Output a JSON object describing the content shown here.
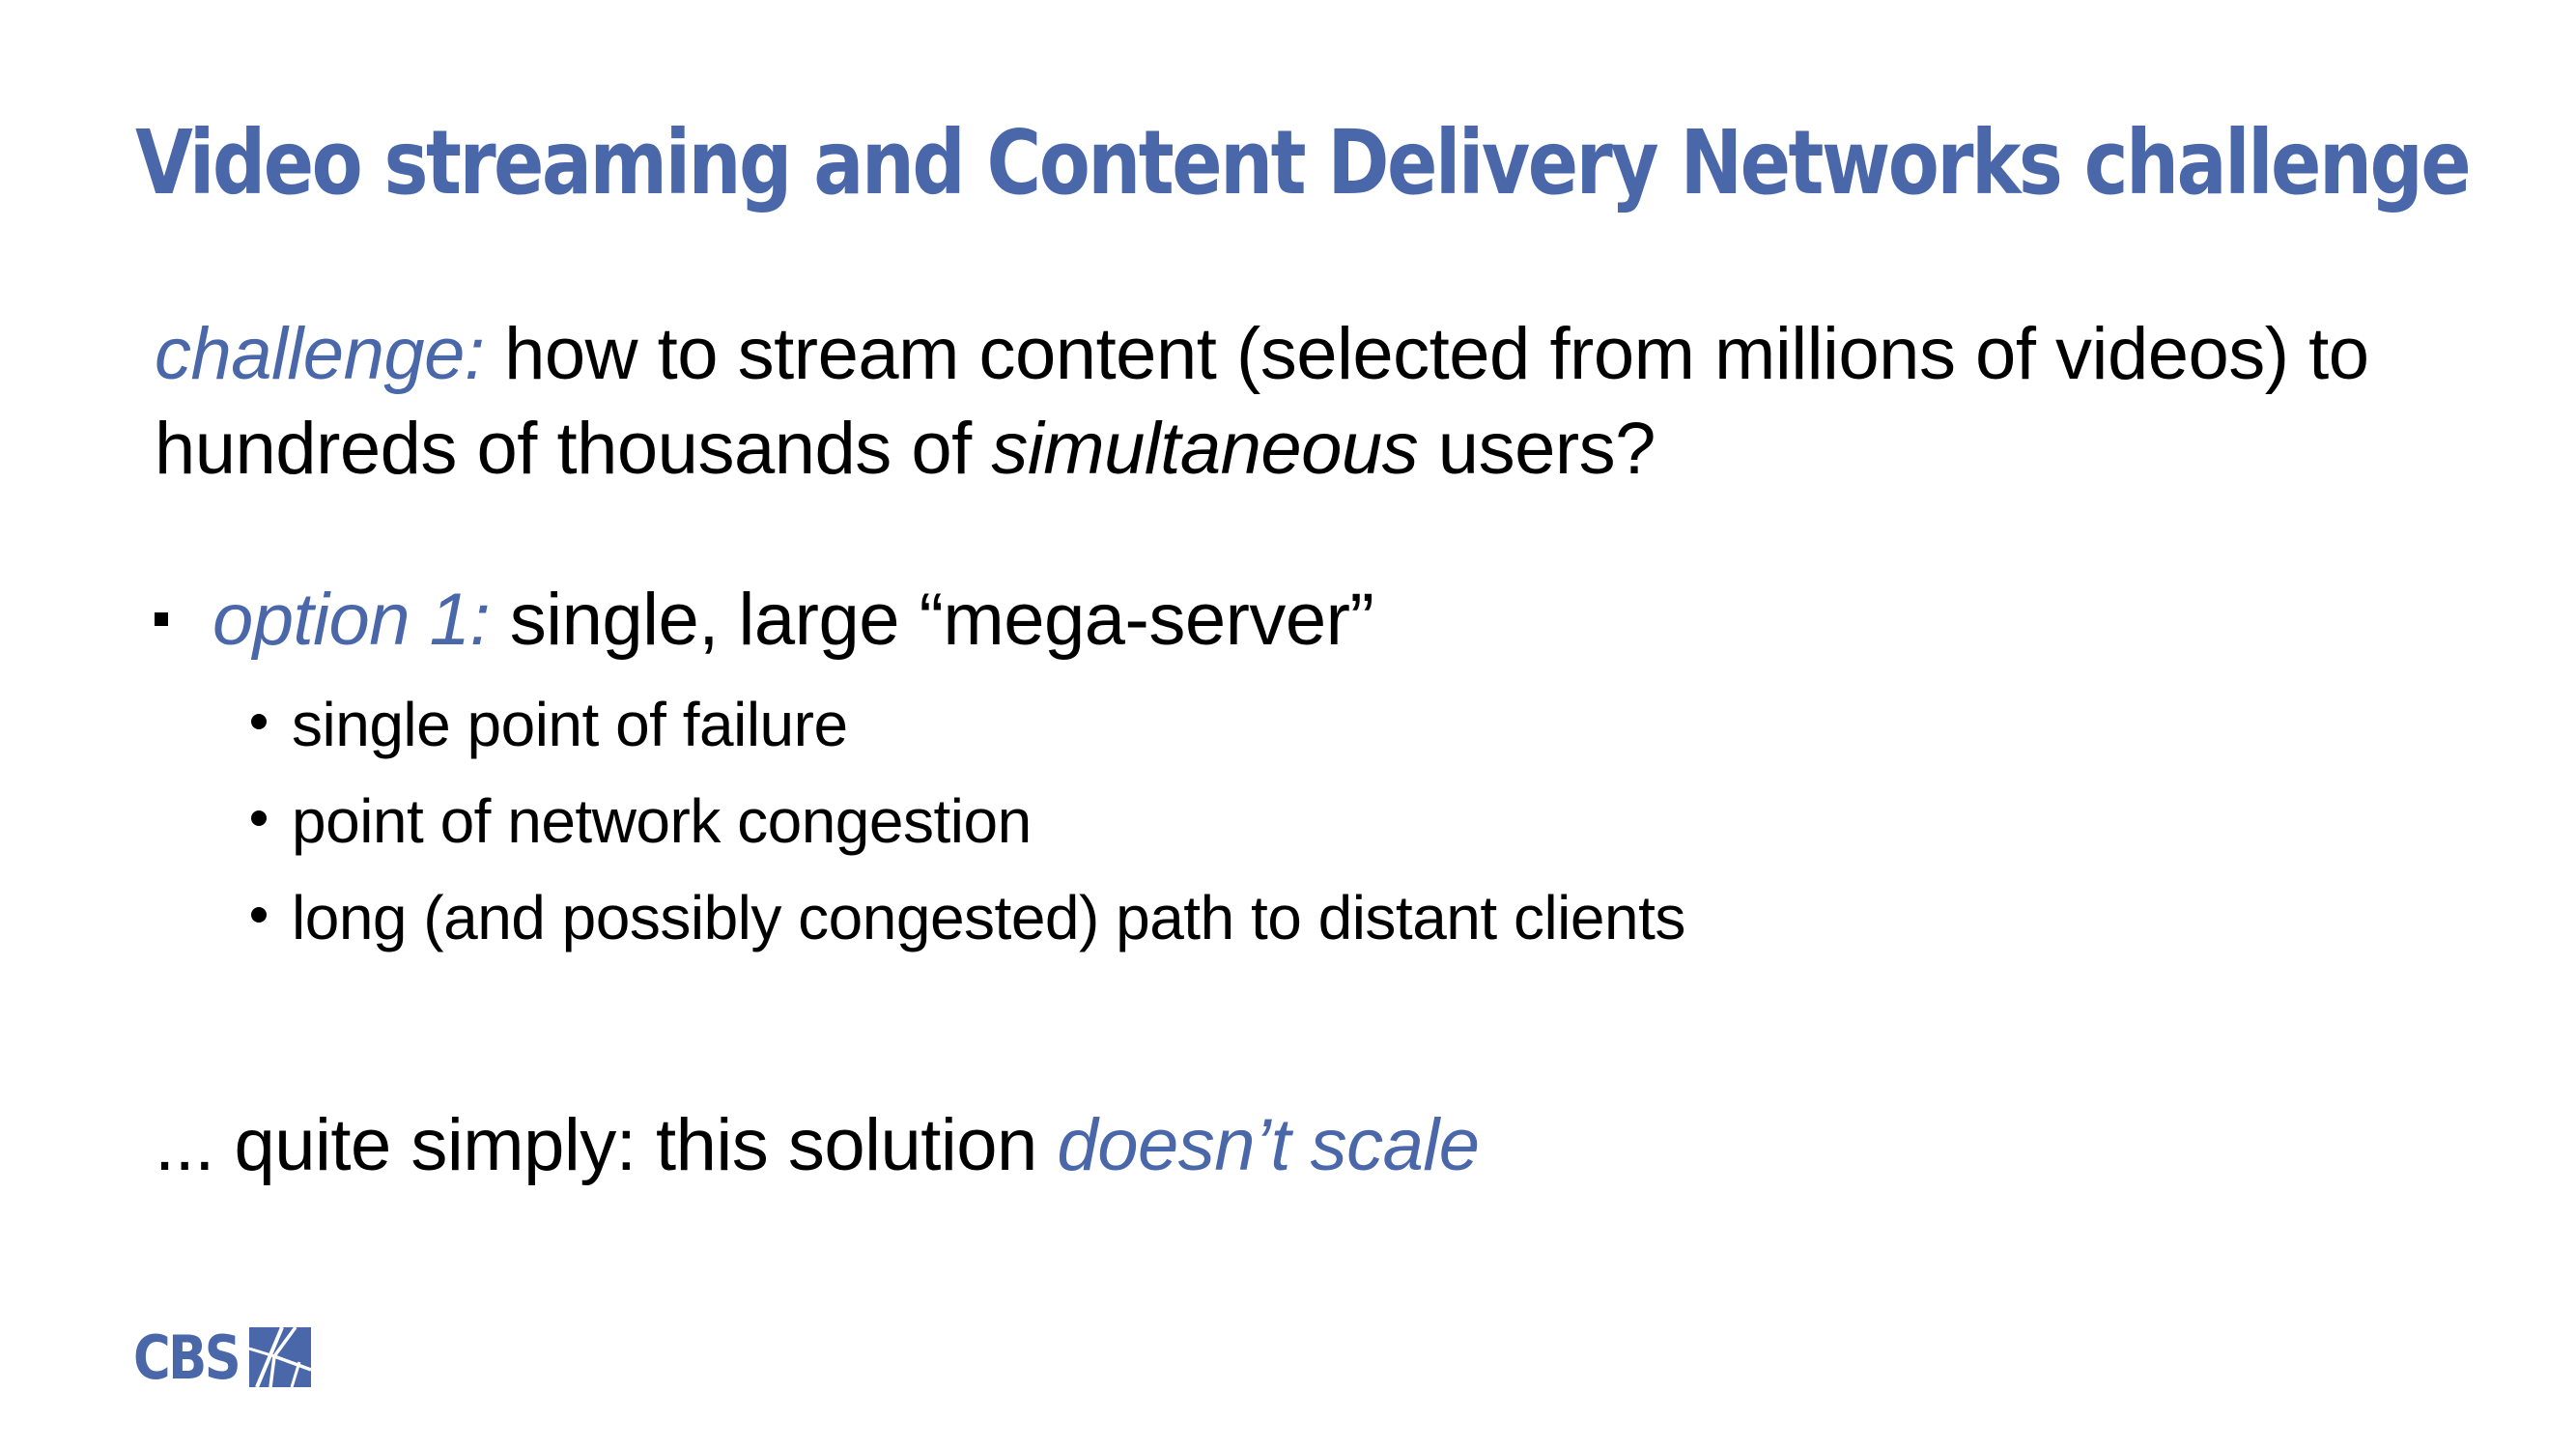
{
  "title": "Video streaming and Content Delivery Networks challenge",
  "intro": {
    "label": "challenge:",
    "text_1": " how to stream content (selected from millions of videos) to hundreds of thousands of ",
    "emphasis": "simultaneous",
    "text_2": " users?"
  },
  "option": {
    "label": "option 1:",
    "text": " single, large “mega-server”"
  },
  "drawbacks": [
    "single point of failure",
    "point of network congestion",
    "long (and possibly congested) path to distant clients"
  ],
  "conclusion": {
    "text": "... quite simply: this solution ",
    "emphasis": "doesn’t scale"
  },
  "logo": {
    "text": "CBS"
  },
  "colors": {
    "accent": "#4a67aa",
    "text": "#000000",
    "background": "#ffffff"
  }
}
